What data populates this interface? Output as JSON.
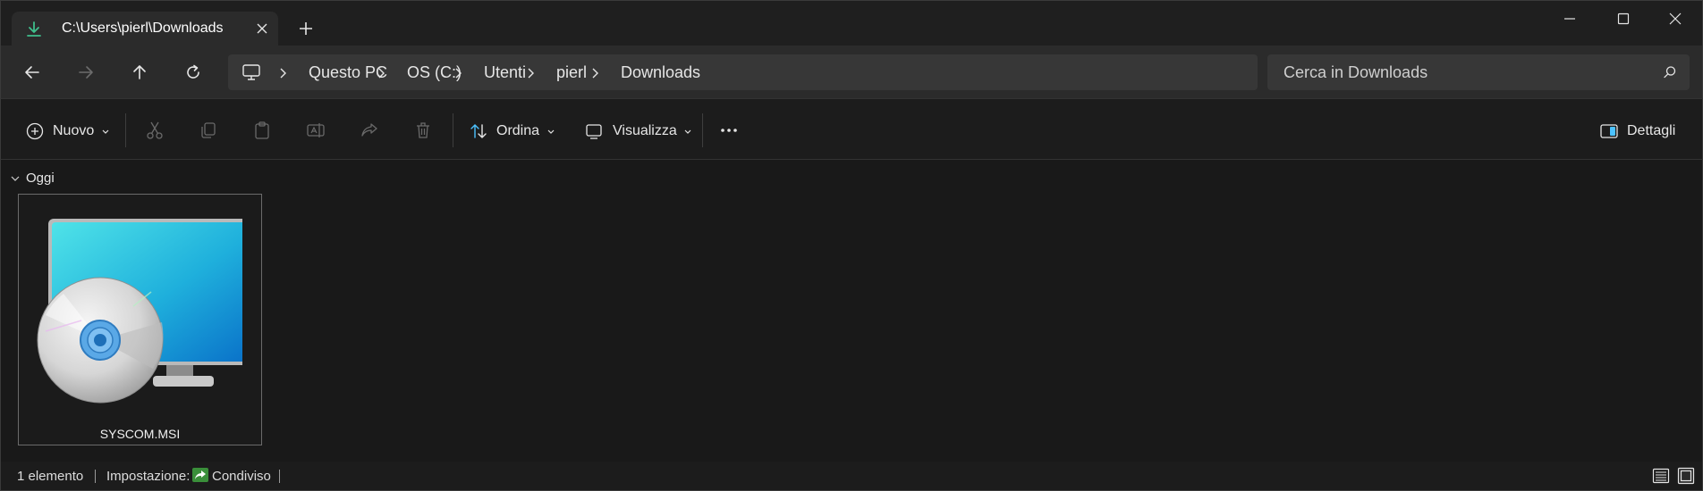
{
  "tab": {
    "title": "C:\\Users\\pierl\\Downloads",
    "icon": "download-icon"
  },
  "window_controls": [
    "minimize-icon",
    "maximize-icon",
    "close-icon"
  ],
  "address": {
    "breadcrumbs": [
      "Questo PC",
      "OS (C:)",
      "Utenti",
      "pierl",
      "Downloads"
    ]
  },
  "search": {
    "placeholder": "Cerca in Downloads"
  },
  "toolbar": {
    "new_label": "Nuovo",
    "sort_label": "Ordina",
    "view_label": "Visualizza",
    "details_label": "Dettagli",
    "disabled_actions": [
      "cut-icon",
      "copy-icon",
      "paste-icon",
      "rename-icon",
      "share-icon",
      "delete-icon"
    ]
  },
  "content": {
    "group_label": "Oggi",
    "files": [
      {
        "name": "SYSCOM.MSI",
        "icon": "msi-installer-icon"
      }
    ]
  },
  "status": {
    "count": "1 elemento",
    "setting_label": "Impostazione:",
    "shared_label": "Condiviso"
  },
  "colors": {
    "accent": "#4cc2ff",
    "download_green": "#3fbf8c",
    "background": "#191919"
  }
}
